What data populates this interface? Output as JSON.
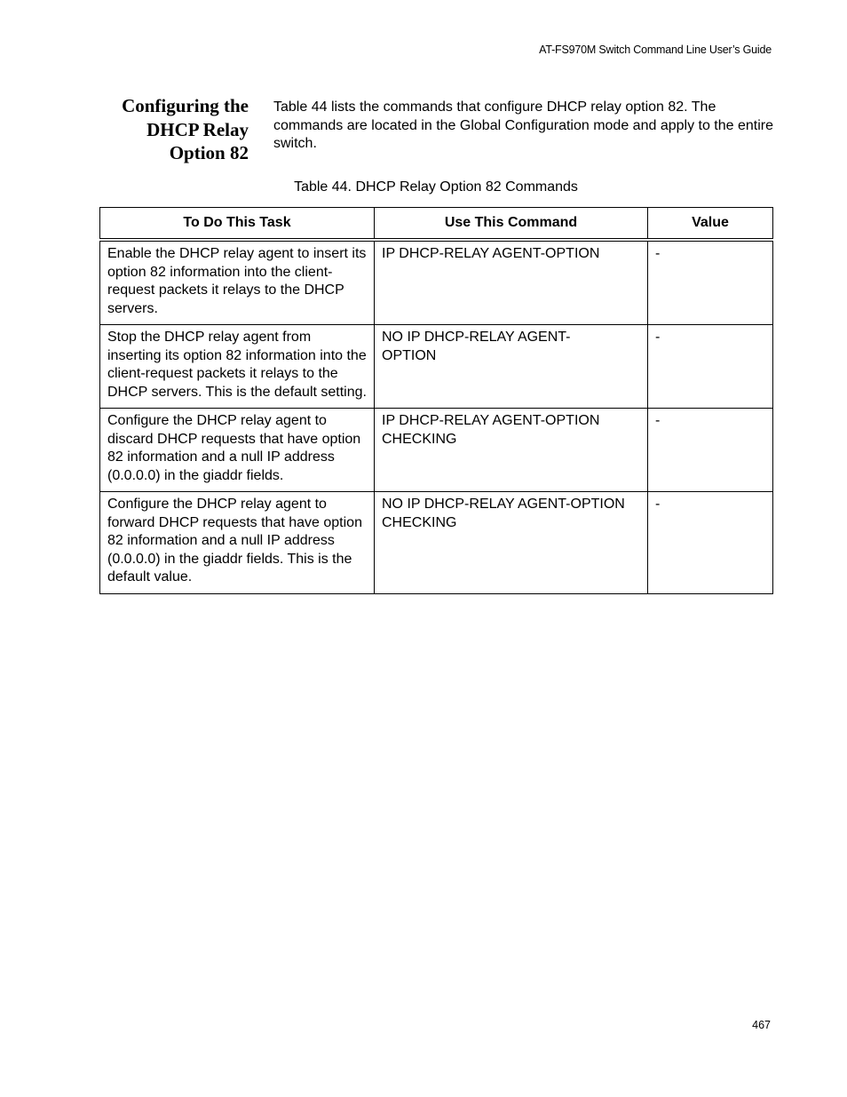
{
  "header": {
    "running_title": "AT-FS970M Switch Command Line User’s Guide"
  },
  "section": {
    "heading_lines": [
      "Configuring the",
      "DHCP Relay",
      "Option 82"
    ],
    "intro": "Table 44 lists the commands that configure DHCP relay option 82. The commands are located in the Global Configuration mode and apply to the entire switch."
  },
  "table": {
    "caption": "Table 44. DHCP Relay Option 82 Commands",
    "columns": [
      "To Do This Task",
      "Use This Command",
      "Value"
    ],
    "rows": [
      {
        "task": "Enable the DHCP relay agent to insert its option 82 information into the client-request packets it relays to the DHCP servers.",
        "command": "IP DHCP-RELAY AGENT-OPTION",
        "value": "-"
      },
      {
        "task": "Stop the DHCP relay agent from inserting its option 82 information into the client-request packets it relays to the DHCP servers. This is the default setting.",
        "command": "NO IP DHCP-RELAY AGENT-OPTION",
        "value": "-"
      },
      {
        "task": "Configure the DHCP relay agent to discard DHCP requests that have option 82 information and a null IP address (0.0.0.0) in the giaddr fields.",
        "command": "IP DHCP-RELAY AGENT-OPTION CHECKING",
        "value": "-"
      },
      {
        "task": "Configure the DHCP relay agent to forward DHCP requests that have option 82 information and a null IP address (0.0.0.0) in the giaddr fields. This is the default value.",
        "command": "NO IP DHCP-RELAY AGENT-OPTION CHECKING",
        "value": "-"
      }
    ]
  },
  "footer": {
    "page_number": "467"
  }
}
